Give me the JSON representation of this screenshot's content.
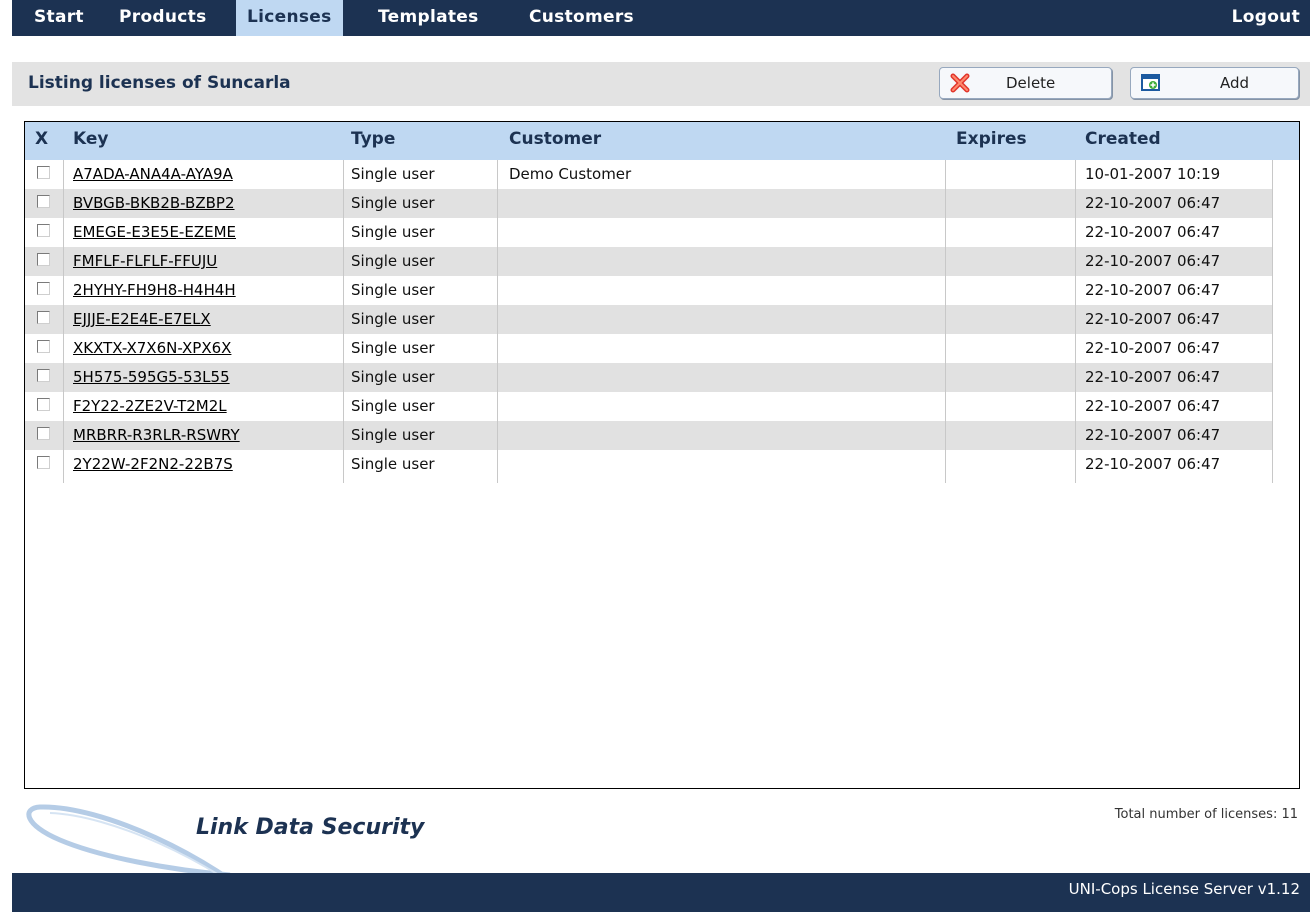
{
  "nav": {
    "start": "Start",
    "products": "Products",
    "licenses": "Licenses",
    "templates": "Templates",
    "customers": "Customers",
    "logout": "Logout",
    "active": "Licenses"
  },
  "header": {
    "title": "Listing licenses of Suncarla",
    "delete_label": "Delete",
    "add_label": "Add",
    "delete_icon": "red-x-icon",
    "add_icon": "add-window-icon"
  },
  "table": {
    "columns": {
      "x": "X",
      "key": "Key",
      "type": "Type",
      "customer": "Customer",
      "expires": "Expires",
      "created": "Created"
    },
    "rows": [
      {
        "key": "A7ADA-ANA4A-AYA9A",
        "type": "Single user",
        "customer": "Demo Customer",
        "expires": "",
        "created": "10-01-2007 10:19"
      },
      {
        "key": "BVBGB-BKB2B-BZBP2",
        "type": "Single user",
        "customer": "",
        "expires": "",
        "created": "22-10-2007 06:47"
      },
      {
        "key": "EMEGE-E3E5E-EZEME",
        "type": "Single user",
        "customer": "",
        "expires": "",
        "created": "22-10-2007 06:47"
      },
      {
        "key": "FMFLF-FLFLF-FFUJU",
        "type": "Single user",
        "customer": "",
        "expires": "",
        "created": "22-10-2007 06:47"
      },
      {
        "key": "2HYHY-FH9H8-H4H4H",
        "type": "Single user",
        "customer": "",
        "expires": "",
        "created": "22-10-2007 06:47"
      },
      {
        "key": "EJJJE-E2E4E-E7ELX",
        "type": "Single user",
        "customer": "",
        "expires": "",
        "created": "22-10-2007 06:47"
      },
      {
        "key": "XKXTX-X7X6N-XPX6X",
        "type": "Single user",
        "customer": "",
        "expires": "",
        "created": "22-10-2007 06:47"
      },
      {
        "key": "5H575-595G5-53L55",
        "type": "Single user",
        "customer": "",
        "expires": "",
        "created": "22-10-2007 06:47"
      },
      {
        "key": "F2Y22-2ZE2V-T2M2L",
        "type": "Single user",
        "customer": "",
        "expires": "",
        "created": "22-10-2007 06:47"
      },
      {
        "key": "MRBRR-R3RLR-RSWRY",
        "type": "Single user",
        "customer": "",
        "expires": "",
        "created": "22-10-2007 06:47"
      },
      {
        "key": "2Y22W-2F2N2-22B7S",
        "type": "Single user",
        "customer": "",
        "expires": "",
        "created": "22-10-2007 06:47"
      }
    ]
  },
  "total_text": "Total number of licenses: 11",
  "brand": "Link Data Security",
  "footer_text": "UNI-Cops License Server v1.12",
  "colors": {
    "navy": "#1c3252",
    "header_blue": "#bfd8f2",
    "row_alt": "#e1e1e1"
  }
}
